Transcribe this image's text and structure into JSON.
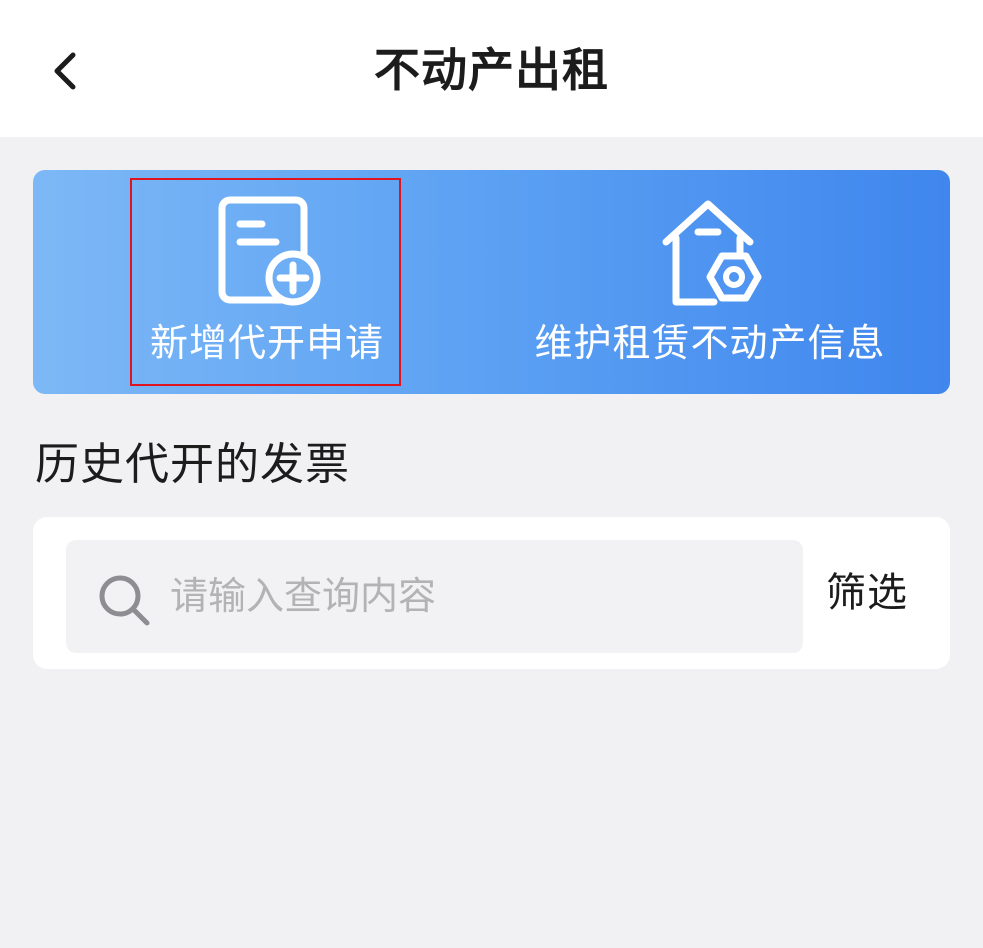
{
  "header": {
    "title": "不动产出租",
    "back_icon": "chevron-left-icon"
  },
  "banner": {
    "actions": [
      {
        "label": "新增代开申请",
        "icon": "document-add-icon"
      },
      {
        "label": "维护租赁不动产信息",
        "icon": "house-settings-icon"
      }
    ],
    "gradient_colors": [
      "#7db8f6",
      "#3f86ee"
    ],
    "highlight_color": "#e0141e"
  },
  "history": {
    "title": "历史代开的发票",
    "search": {
      "placeholder": "请输入查询内容",
      "value": ""
    },
    "filter_label": "筛选"
  }
}
